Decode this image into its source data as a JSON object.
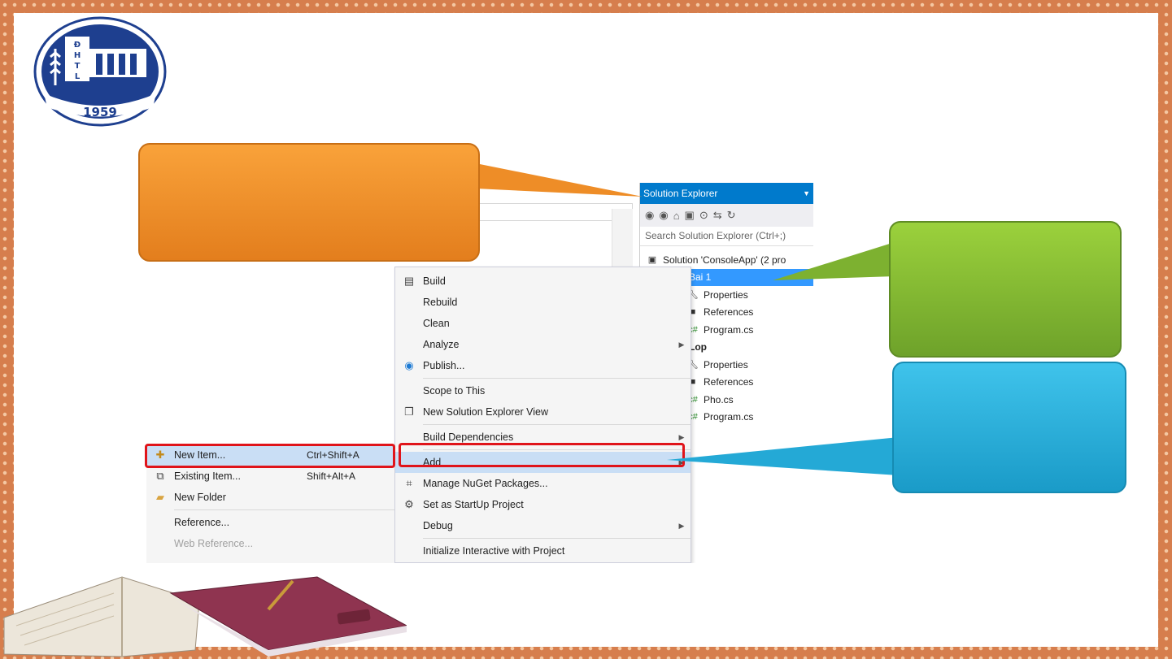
{
  "logo": {
    "letters": [
      "Đ",
      "H",
      "T",
      "L"
    ],
    "year": "1959"
  },
  "solution_explorer": {
    "title": "Solution Explorer",
    "search_placeholder": "Search Solution Explorer (Ctrl+;)",
    "tree": [
      {
        "label": "Solution 'ConsoleApp' (2 pro",
        "icon": "solution-icon"
      },
      {
        "label": "Bai 1",
        "icon": "project-icon",
        "selected": true
      },
      {
        "label": "Properties",
        "icon": "wrench-icon"
      },
      {
        "label": "References",
        "icon": "references-icon"
      },
      {
        "label": "Program.cs",
        "icon": "csharp-file-icon"
      },
      {
        "label": "Lop",
        "icon": "project-icon",
        "bold": true
      },
      {
        "label": "Properties",
        "icon": "wrench-icon"
      },
      {
        "label": "References",
        "icon": "references-icon"
      },
      {
        "label": "Pho.cs",
        "icon": "csharp-file-icon"
      },
      {
        "label": "Program.cs",
        "icon": "csharp-file-icon"
      }
    ]
  },
  "context_menu": {
    "items": [
      {
        "label": "Build",
        "icon": "build-icon"
      },
      {
        "label": "Rebuild"
      },
      {
        "label": "Clean"
      },
      {
        "label": "Analyze",
        "submenu": true
      },
      {
        "label": "Publish...",
        "icon": "publish-icon"
      },
      {
        "label": "Scope to This"
      },
      {
        "label": "New Solution Explorer View",
        "icon": "new-view-icon"
      },
      {
        "label": "Build Dependencies",
        "submenu": true
      },
      {
        "label": "Add",
        "submenu": true,
        "highlighted": true
      },
      {
        "label": "Manage NuGet Packages...",
        "icon": "nuget-icon"
      },
      {
        "label": "Set as StartUp Project",
        "icon": "gear-icon"
      },
      {
        "label": "Debug",
        "submenu": true
      },
      {
        "label": "Initialize Interactive with Project"
      }
    ]
  },
  "add_submenu": {
    "items": [
      {
        "label": "New Item...",
        "shortcut": "Ctrl+Shift+A",
        "icon": "new-item-icon",
        "highlighted": true
      },
      {
        "label": "Existing Item...",
        "shortcut": "Shift+Alt+A",
        "icon": "existing-item-icon"
      },
      {
        "label": "New Folder",
        "shortcut": "",
        "icon": "folder-icon"
      },
      {
        "label": "Reference...",
        "shortcut": ""
      },
      {
        "label": "Web Reference...",
        "shortcut": "",
        "disabled": true
      }
    ]
  },
  "colors": {
    "orange_callout": "#f39a2f",
    "green_callout": "#86bd34",
    "blue_callout": "#2bb2de",
    "highlight_box": "#e0141a",
    "vs_blue": "#007acc"
  }
}
